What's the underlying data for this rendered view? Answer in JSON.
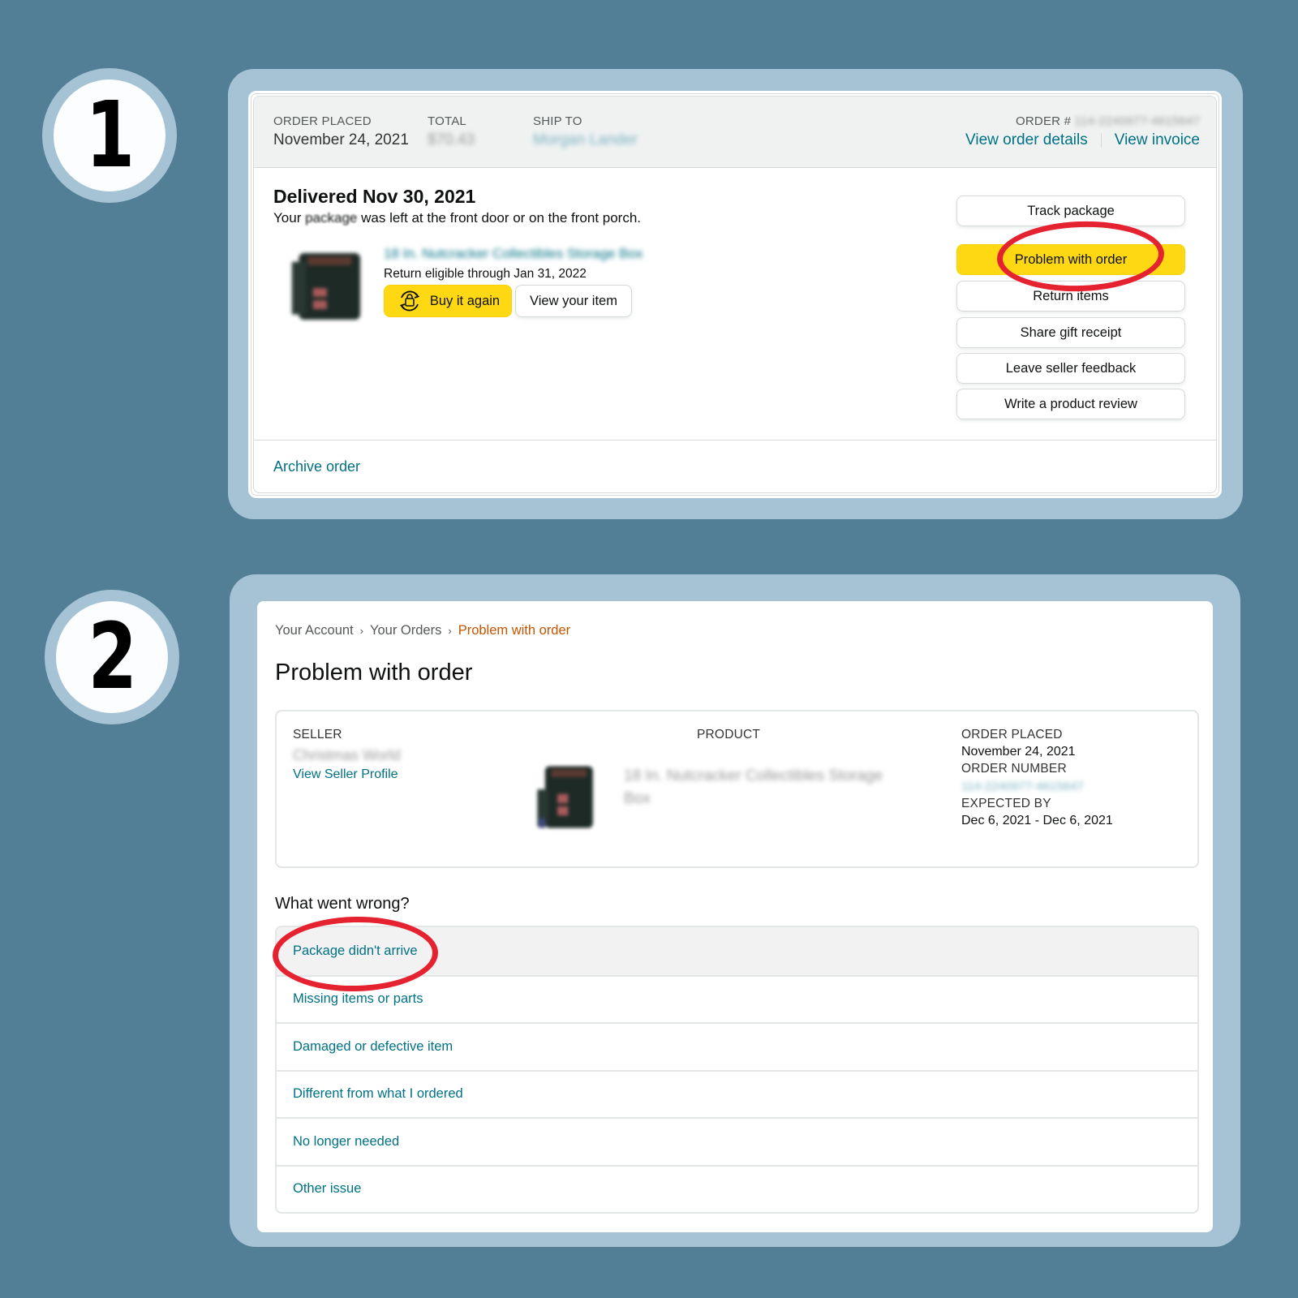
{
  "steps": [
    {
      "number": "1"
    },
    {
      "number": "2"
    }
  ],
  "screen1": {
    "header": {
      "order_placed_label": "ORDER PLACED",
      "order_placed_value": "November 24, 2021",
      "total_label": "TOTAL",
      "total_value": "$70.43",
      "ship_to_label": "SHIP TO",
      "ship_to_value": "Morgan Lander",
      "order_number_label": "ORDER #",
      "order_number_value": "114-2240977-4615647",
      "view_order_details": "View order details",
      "view_invoice": "View invoice"
    },
    "delivery": {
      "title": "Delivered Nov 30, 2021",
      "subtitle_prefix": "Your",
      "subtitle_blurred": "package",
      "subtitle_suffix": "was left at the front door or on the front porch."
    },
    "item": {
      "title": "18 In. Nutcracker Collectibles Storage Box",
      "return_eligible": "Return eligible through Jan 31, 2022",
      "buy_again": "Buy it again",
      "view_item": "View your item"
    },
    "actions": [
      "Track package",
      "Problem with order",
      "Return items",
      "Share gift receipt",
      "Leave seller feedback",
      "Write a product review"
    ],
    "archive_order": "Archive order"
  },
  "screen2": {
    "breadcrumb": [
      "Your Account",
      "Your Orders",
      "Problem with order"
    ],
    "page_title": "Problem with order",
    "seller_label": "SELLER",
    "seller_name": "Christmas World",
    "view_seller_profile": "View Seller Profile",
    "product_label": "PRODUCT",
    "product_name": "18 In. Nutcracker Collectibles Storage Box",
    "order_placed_label": "ORDER PLACED",
    "order_placed_value": "November 24, 2021",
    "order_number_label": "ORDER NUMBER",
    "order_number_value": "114-2240977-4615647",
    "expected_by_label": "EXPECTED BY",
    "expected_by_value": "Dec 6, 2021 - Dec 6, 2021",
    "what_went_wrong": "What went wrong?",
    "reasons": [
      "Package didn't arrive",
      "Missing items or parts",
      "Damaged or defective item",
      "Different from what I ordered",
      "No longer needed",
      "Other issue"
    ]
  },
  "colors": {
    "background": "#527f95",
    "panel": "#a5c3d4",
    "link": "#007185",
    "breadcrumb_current": "#c45500",
    "primary_button": "#ffd814",
    "highlight_ellipse": "#e5222f"
  }
}
